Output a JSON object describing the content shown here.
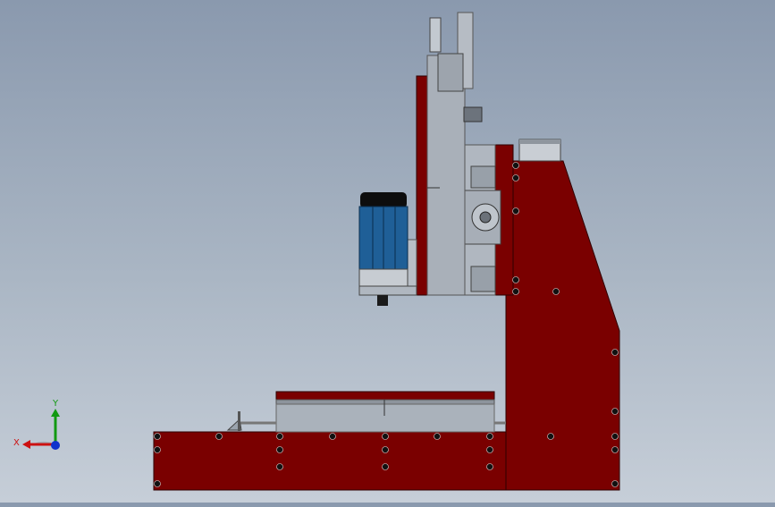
{
  "viewport": {
    "background_top": "#8a99ae",
    "background_bottom": "#c6ced8"
  },
  "model": {
    "frame_color": "#7a0000",
    "frame_edge": "#3a0000",
    "steel_color": "#9aa3ad",
    "motor_blue": "#1f5f97",
    "parts": [
      "base-plate",
      "column-plate",
      "gantry-plate",
      "work-table",
      "z-axis-carriage",
      "spindle-motor",
      "stepper-motor"
    ]
  },
  "triad": {
    "x_label": "X",
    "y_label": "Y",
    "x_color": "#cc1111",
    "y_color": "#119911",
    "z_color": "#1133cc"
  }
}
